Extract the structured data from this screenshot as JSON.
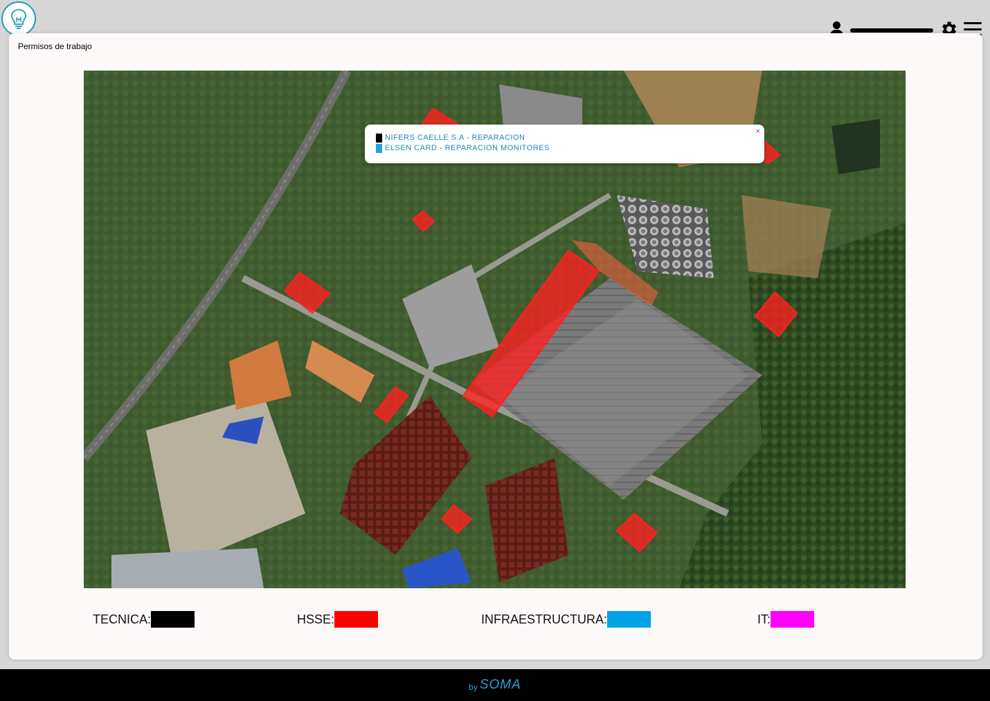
{
  "header": {
    "user_name": "",
    "colors": {
      "logo": "#1b9bb8"
    }
  },
  "page": {
    "title": "Permisos de trabajo"
  },
  "popup": {
    "lines": [
      {
        "text": "NIFERS CAELLE S.A - REPARACION",
        "color": "#000000"
      },
      {
        "text": "ELSEN CARD - REPARACION MONITORES",
        "color": "#1ea0e0"
      }
    ],
    "close_label": "×"
  },
  "legend": [
    {
      "label": "TECNICA:",
      "color": "#000000"
    },
    {
      "label": "HSSE:",
      "color": "#ff0000"
    },
    {
      "label": "INFRAESTRUCTURA:",
      "color": "#00a2e8"
    },
    {
      "label": "IT:",
      "color": "#ff00ff"
    }
  ],
  "footer": {
    "by": "by",
    "brand": "SOMA"
  },
  "map": {
    "zone_color": "#ff2020",
    "zones": [
      "zone-1",
      "zone-2",
      "zone-3",
      "zone-4",
      "zone-5",
      "zone-6",
      "zone-7",
      "zone-8",
      "zone-9",
      "zone-10"
    ]
  }
}
